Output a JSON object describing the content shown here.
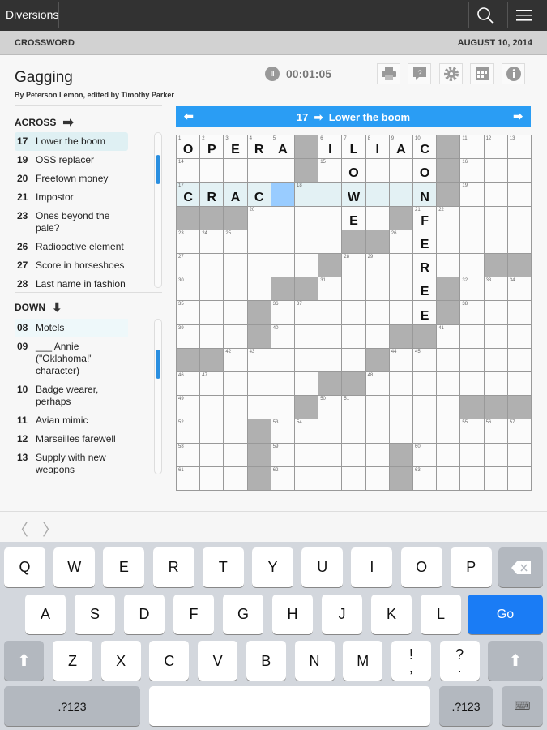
{
  "app": {
    "brand": "Diversions",
    "search_icon": "search-icon",
    "menu_icon": "menu-icon"
  },
  "subheader": {
    "section": "CROSSWORD",
    "date": "AUGUST 10, 2014"
  },
  "puzzle": {
    "title": "Gagging",
    "byline": "By Peterson Lemon, edited by Timothy Parker",
    "timer": "00:01:05"
  },
  "toolbar": [
    "print-icon",
    "help-icon",
    "gear-icon",
    "grid-icon",
    "info-icon"
  ],
  "current_clue": {
    "number": "17",
    "text": "Lower the boom",
    "direction_arrow": "➡"
  },
  "across": {
    "label": "ACROSS",
    "items": [
      {
        "n": "17",
        "t": "Lower the boom"
      },
      {
        "n": "19",
        "t": "OSS replacer"
      },
      {
        "n": "20",
        "t": "Freetown money"
      },
      {
        "n": "21",
        "t": "Impostor"
      },
      {
        "n": "23",
        "t": "Ones beyond the pale?"
      },
      {
        "n": "26",
        "t": "Radioactive element"
      },
      {
        "n": "27",
        "t": "Score in horseshoes"
      },
      {
        "n": "28",
        "t": "Last name in fashion"
      }
    ]
  },
  "down": {
    "label": "DOWN",
    "items": [
      {
        "n": "08",
        "t": "Motels"
      },
      {
        "n": "09",
        "t": "___ Annie (\"Oklahoma!\" character)"
      },
      {
        "n": "10",
        "t": "Badge wearer, perhaps"
      },
      {
        "n": "11",
        "t": "Avian mimic"
      },
      {
        "n": "12",
        "t": "Marseilles farewell"
      },
      {
        "n": "13",
        "t": "Supply with new weapons"
      }
    ]
  },
  "grid": {
    "rows": [
      "OPERA#ILIAC#...",
      ".....#.O..O#...",
      "CRAC...W..N#...",
      "###....E.#F....",
      ".......##.E....",
      "......#...R..##",
      "....##....E#...",
      "...#......E#...",
      "...#.....##....",
      "##......#......",
      "......##.......",
      ".....#......###",
      "...#...........",
      "...#.....#.....",
      "...#.....#....."
    ],
    "highlight_row": 2,
    "highlight_cols": [
      0,
      10
    ],
    "cursor": [
      2,
      4
    ]
  },
  "colors": {
    "accent": "#2a9df4",
    "highlight": "#e3f1f4",
    "cursor": "#99ccff",
    "block": "#b0b0b0"
  },
  "keyboard": {
    "row1": [
      "Q",
      "W",
      "E",
      "R",
      "T",
      "Y",
      "U",
      "I",
      "O",
      "P"
    ],
    "row2": [
      "A",
      "S",
      "D",
      "F",
      "G",
      "H",
      "J",
      "K",
      "L"
    ],
    "row3": [
      "Z",
      "X",
      "C",
      "V",
      "B",
      "N",
      "M",
      "!\n,",
      "?\n."
    ],
    "go": "Go",
    "numbers": ".?123"
  }
}
